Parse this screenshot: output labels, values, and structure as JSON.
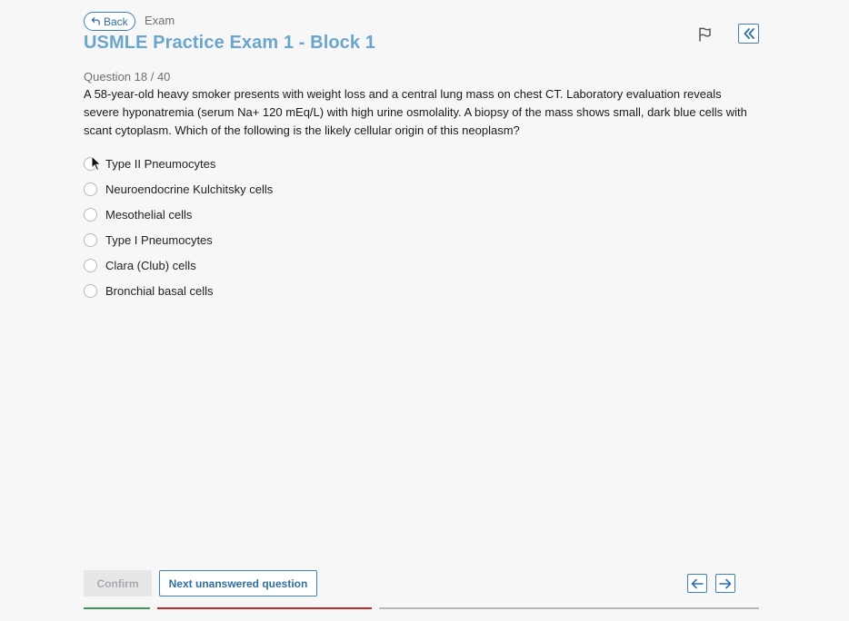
{
  "header": {
    "back_label": "Back",
    "breadcrumb": "Exam",
    "title": "USMLE Practice Exam 1 - Block 1"
  },
  "question": {
    "counter": "Question 18 / 40",
    "text": "A 58-year-old heavy smoker presents with weight loss and a central lung mass on chest CT. Laboratory evaluation reveals severe hyponatremia (serum Na+ 120 mEq/L) with high urine osmolality. A biopsy of the mass shows small, dark blue cells with scant cytoplasm. Which of the following is the likely cellular origin of this neoplasm?",
    "options": [
      {
        "label": "Type II Pneumocytes"
      },
      {
        "label": "Neuroendocrine Kulchitsky cells"
      },
      {
        "label": "Mesothelial cells"
      },
      {
        "label": "Type I Pneumocytes"
      },
      {
        "label": "Clara (Club) cells"
      },
      {
        "label": "Bronchial basal cells"
      }
    ]
  },
  "footer": {
    "confirm_label": "Confirm",
    "next_unanswered_label": "Next unanswered question"
  },
  "icons": {
    "back": "undo-arrow-icon",
    "flag": "flag-icon",
    "collapse": "double-chevron-left-icon",
    "prev": "arrow-left-icon",
    "next": "arrow-right-icon"
  },
  "colors": {
    "accent": "#3d7fb6",
    "title": "#6aa6cc",
    "progress_correct": "#3a9a55",
    "progress_incorrect": "#c8262a",
    "progress_remaining": "#b8b8b8"
  }
}
